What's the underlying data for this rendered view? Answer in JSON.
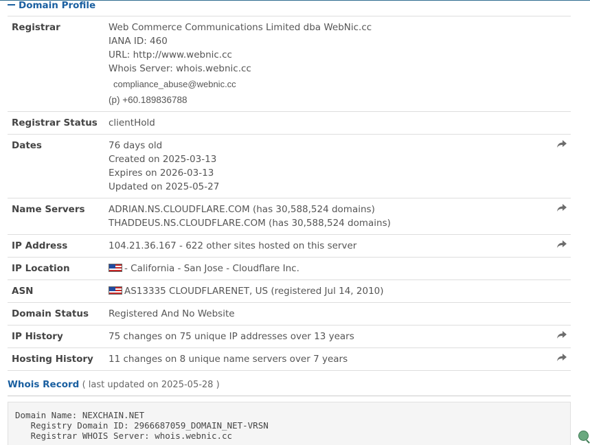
{
  "profile": {
    "title": "Domain Profile",
    "rows": {
      "registrar": {
        "label": "Registrar",
        "name": "Web Commerce Communications Limited dba WebNic.cc",
        "iana": "IANA ID: 460",
        "url": "URL: http://www.webnic.cc",
        "whois_server": "Whois Server: whois.webnic.cc",
        "email": "compliance_abuse@webnic.cc",
        "phone": "(p) +60.189836788"
      },
      "registrar_status": {
        "label": "Registrar Status",
        "value": "clientHold"
      },
      "dates": {
        "label": "Dates",
        "age": "76 days old",
        "created": "Created on 2025-03-13",
        "expires": "Expires on 2026-03-13",
        "updated": "Updated on 2025-05-27"
      },
      "name_servers": {
        "label": "Name Servers",
        "ns1": "ADRIAN.NS.CLOUDFLARE.COM (has 30,588,524 domains)",
        "ns2": "THADDEUS.NS.CLOUDFLARE.COM (has 30,588,524 domains)"
      },
      "ip_address": {
        "label": "IP Address",
        "value": "104.21.36.167 - 622 other sites hosted on this server"
      },
      "ip_location": {
        "label": "IP Location",
        "value": "- California - San Jose - Cloudflare Inc."
      },
      "asn": {
        "label": "ASN",
        "value": "AS13335 CLOUDFLARENET, US (registered Jul 14, 2010)"
      },
      "domain_status": {
        "label": "Domain Status",
        "value": "Registered And No Website"
      },
      "ip_history": {
        "label": "IP History",
        "value": "75 changes on 75 unique IP addresses over 13 years"
      },
      "hosting_history": {
        "label": "Hosting History",
        "value": "11 changes on 8 unique name servers over 7 years"
      }
    }
  },
  "whois": {
    "title": "Whois Record",
    "subtitle": "( last updated on 2025-05-28 )",
    "lines": [
      "Domain Name: NEXCHAIN.NET",
      "   Registry Domain ID: 2966687059_DOMAIN_NET-VRSN",
      "   Registrar WHOIS Server: whois.webnic.cc"
    ]
  },
  "icons": {
    "share": "share-arrow-icon",
    "flag": "us-flag-icon",
    "zoom": "zoom-icon"
  },
  "colors": {
    "accent": "#1a5fa0",
    "border": "#dddddd",
    "whois_bg": "#f5f5f5"
  }
}
